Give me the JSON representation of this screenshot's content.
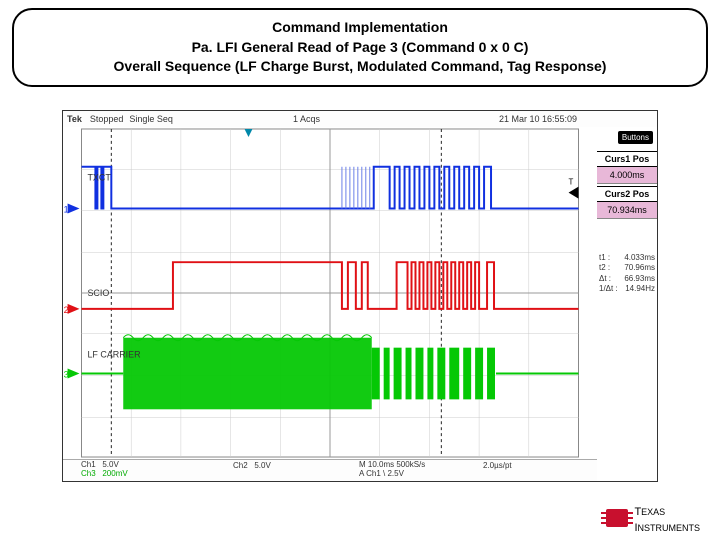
{
  "title": {
    "line1": "Command Implementation",
    "line2": "Pa. LFI General Read of Page 3 (Command 0 x 0 C)",
    "line3": "Overall Sequence (LF Charge Burst, Modulated Command, Tag Response)"
  },
  "scope": {
    "brand": "Tek",
    "status1": "Stopped",
    "status2": "Single Seq",
    "acqs": "1 Acqs",
    "date": "21 Mar 10 16:55:09",
    "buttons_label": "Buttons",
    "curs1_label": "Curs1 Pos",
    "curs1_value": "4.000ms",
    "curs2_label": "Curs2 Pos",
    "curs2_value": "70.934ms",
    "readout": {
      "t1_label": "t1 :",
      "t1_val": "4.033ms",
      "t2_label": "t2 :",
      "t2_val": "70.96ms",
      "dt_label": "Δt :",
      "dt_val": "66.93ms",
      "f_label": "1/Δt :",
      "f_val": "14.94Hz"
    },
    "ch1_label": "Ch1",
    "ch1_scale": "5.0V",
    "ch2_label": "Ch2",
    "ch2_scale": "5.0V",
    "ch3_label": "Ch3",
    "ch3_scale": "200mV",
    "timebase": "M 10.0ms 500kS/s",
    "pts": "2.0µs/pt",
    "trigger": "A  Ch1  \\  2.5V",
    "traces": {
      "txct_label": "TXCT",
      "scio_label": "SCIO",
      "lfcarrier_label": "LF CARRIER"
    }
  },
  "footer": {
    "brand": "TEXAS INSTRUMENTS"
  }
}
